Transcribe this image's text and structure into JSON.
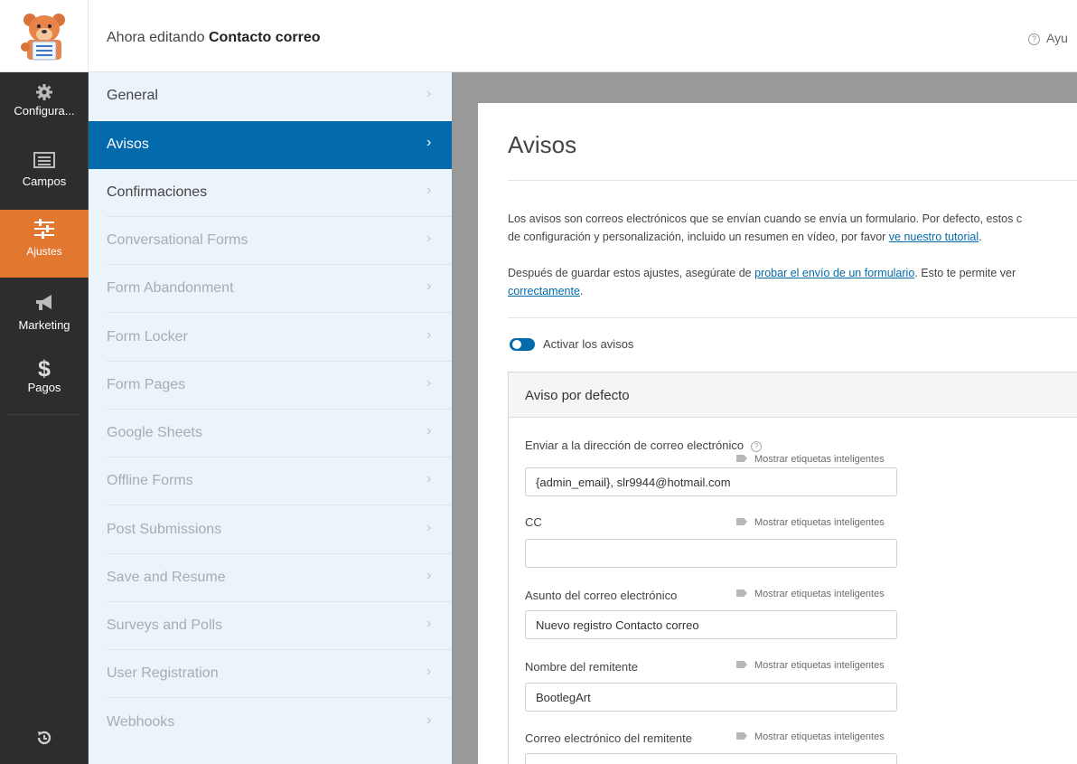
{
  "header": {
    "editing_prefix": "Ahora editando",
    "form_name": "Contacto correo",
    "help_label": "Ayu"
  },
  "icon_bar": {
    "items": [
      {
        "label": "Configura...",
        "icon": "gear-icon"
      },
      {
        "label": "Campos",
        "icon": "fields-icon"
      },
      {
        "label": "Ajustes",
        "icon": "sliders-icon",
        "active": true
      },
      {
        "label": "Marketing",
        "icon": "megaphone-icon"
      },
      {
        "label": "Pagos",
        "icon": "dollar-icon"
      }
    ],
    "history_icon": "history-icon"
  },
  "settings_menu": {
    "items": [
      {
        "label": "General",
        "state": "normal"
      },
      {
        "label": "Avisos",
        "state": "active"
      },
      {
        "label": "Confirmaciones",
        "state": "normal"
      },
      {
        "label": "Conversational Forms",
        "state": "disabled"
      },
      {
        "label": "Form Abandonment",
        "state": "disabled"
      },
      {
        "label": "Form Locker",
        "state": "disabled"
      },
      {
        "label": "Form Pages",
        "state": "disabled"
      },
      {
        "label": "Google Sheets",
        "state": "disabled"
      },
      {
        "label": "Offline Forms",
        "state": "disabled"
      },
      {
        "label": "Post Submissions",
        "state": "disabled"
      },
      {
        "label": "Save and Resume",
        "state": "disabled"
      },
      {
        "label": "Surveys and Polls",
        "state": "disabled"
      },
      {
        "label": "User Registration",
        "state": "disabled"
      },
      {
        "label": "Webhooks",
        "state": "disabled"
      }
    ]
  },
  "main": {
    "title": "Avisos",
    "intro_line1": "Los avisos son correos electrónicos que se envían cuando se envía un formulario. Por defecto, estos c",
    "intro_line2_prefix": "de configuración y personalización, incluido un resumen en vídeo, por favor ",
    "intro_link": "ve nuestro tutorial",
    "intro_line2_suffix": ".",
    "test_prefix": "Después de guardar estos ajustes, asegúrate de ",
    "test_link": "probar el envío de un formulario",
    "test_suffix": ". Esto te permite ver",
    "test_link2": "correctamente",
    "test_end": ".",
    "toggle_label": "Activar los avisos",
    "toggle_on": true,
    "notice": {
      "title": "Aviso por defecto",
      "smart_tags_label": "Mostrar etiquetas inteligentes",
      "fields": [
        {
          "label": "Enviar a la dirección de correo electrónico",
          "value": "{admin_email}, slr9944@hotmail.com",
          "has_help": true
        },
        {
          "label": "CC",
          "value": ""
        },
        {
          "label": "Asunto del correo electrónico",
          "value": "Nuevo registro Contacto correo"
        },
        {
          "label": "Nombre del remitente",
          "value": "BootlegArt"
        },
        {
          "label": "Correo electrónico del remitente",
          "value": ""
        }
      ]
    }
  }
}
